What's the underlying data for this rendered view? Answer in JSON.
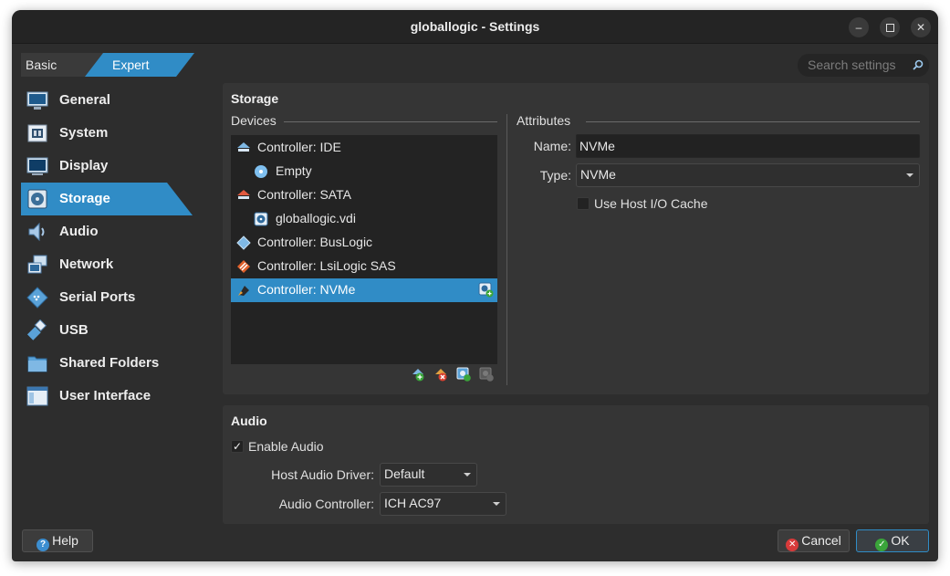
{
  "window": {
    "title": "globallogic - Settings"
  },
  "mode_tabs": {
    "basic": "Basic",
    "expert": "Expert",
    "active": "Expert"
  },
  "search": {
    "placeholder": "Search settings"
  },
  "sidebar": {
    "active": "Storage",
    "items": [
      {
        "label": "General",
        "icon": "monitor-icon"
      },
      {
        "label": "System",
        "icon": "chip-icon"
      },
      {
        "label": "Display",
        "icon": "display-icon"
      },
      {
        "label": "Storage",
        "icon": "disk-icon"
      },
      {
        "label": "Audio",
        "icon": "speaker-icon"
      },
      {
        "label": "Network",
        "icon": "network-icon"
      },
      {
        "label": "Serial Ports",
        "icon": "serial-port-icon"
      },
      {
        "label": "USB",
        "icon": "usb-icon"
      },
      {
        "label": "Shared Folders",
        "icon": "folder-icon"
      },
      {
        "label": "User Interface",
        "icon": "window-icon"
      }
    ]
  },
  "storage": {
    "title": "Storage",
    "devices_label": "Devices",
    "tree": [
      {
        "label": "Controller: IDE",
        "level": 0,
        "icon": "ide-controller-icon"
      },
      {
        "label": "Empty",
        "level": 1,
        "icon": "optical-disc-icon"
      },
      {
        "label": "Controller: SATA",
        "level": 0,
        "icon": "sata-controller-icon"
      },
      {
        "label": "globallogic.vdi",
        "level": 1,
        "icon": "hard-disk-icon"
      },
      {
        "label": "Controller: BusLogic",
        "level": 0,
        "icon": "buslogic-controller-icon"
      },
      {
        "label": "Controller: LsiLogic SAS",
        "level": 0,
        "icon": "lsilogic-controller-icon"
      },
      {
        "label": "Controller: NVMe",
        "level": 0,
        "icon": "nvme-controller-icon",
        "selected": true
      }
    ],
    "attributes_label": "Attributes",
    "name_label": "Name:",
    "name_value": "NVMe",
    "type_label": "Type:",
    "type_value": "NVMe",
    "host_io_cache_label": "Use Host I/O Cache",
    "host_io_cache_checked": false
  },
  "audio": {
    "title": "Audio",
    "enable_label": "Enable Audio",
    "enable_checked": true,
    "host_driver_label": "Host Audio Driver:",
    "host_driver_value": "Default",
    "controller_label": "Audio Controller:",
    "controller_value": "ICH AC97"
  },
  "buttons": {
    "help": "Help",
    "cancel": "Cancel",
    "ok": "OK"
  },
  "colors": {
    "accent": "#308cc6",
    "window_bg": "#2d2d2d",
    "panel_bg": "#353535"
  }
}
